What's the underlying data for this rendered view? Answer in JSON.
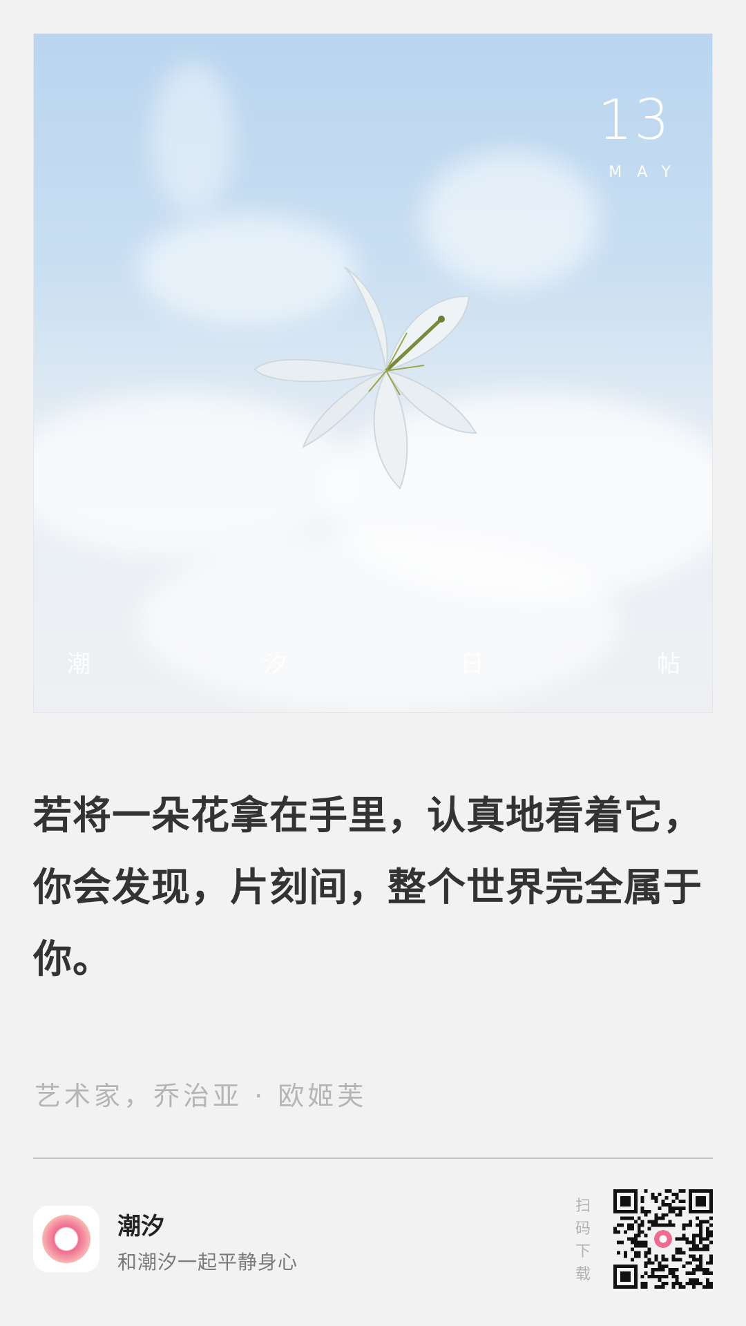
{
  "hero": {
    "day": "13",
    "month": "MAY",
    "brand_chars": [
      "潮",
      "汐",
      "日",
      "帖"
    ]
  },
  "quote": {
    "text": "若将一朵花拿在手里，认真地看着它，你会发现，片刻间，整个世界完全属于你。",
    "author": "艺术家，乔治亚 · 欧姬芙"
  },
  "footer": {
    "app_name": "潮汐",
    "app_slogan": "和潮汐一起平静身心",
    "scan_label": [
      "扫",
      "码",
      "下",
      "载"
    ]
  },
  "colors": {
    "background": "#f2f2f3",
    "accent": "#f06b8e",
    "text": "#333333",
    "muted": "#b5b5b8"
  },
  "icons": {
    "app_icon": "tide-ring-icon",
    "qr_code": "qr-code-icon"
  }
}
